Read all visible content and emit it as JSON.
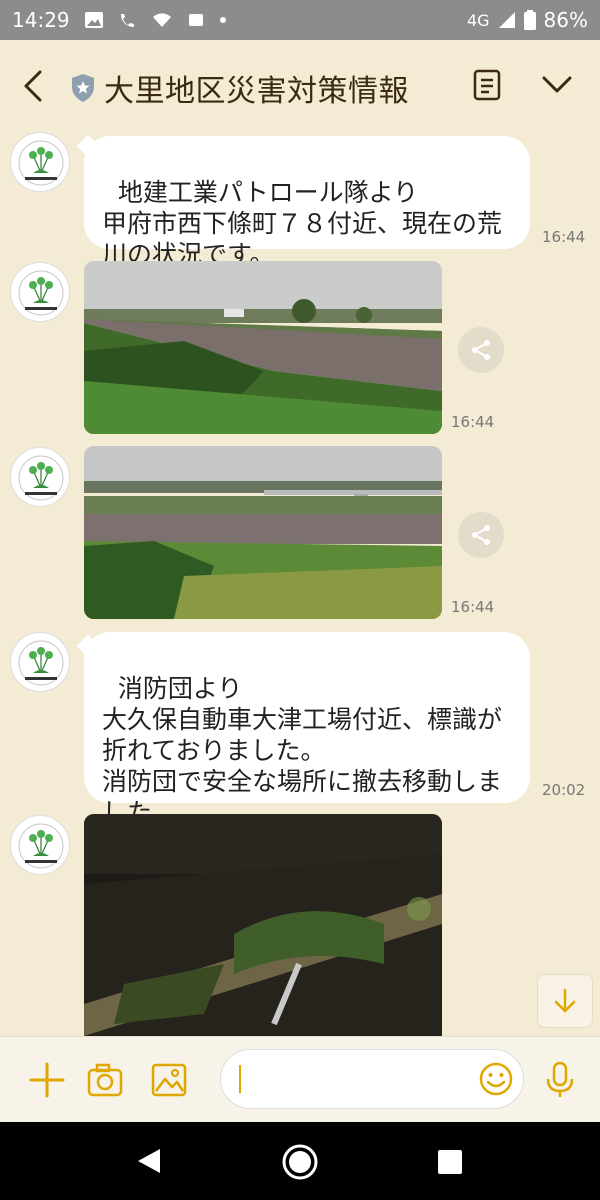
{
  "status_bar": {
    "time": "14:29",
    "network": "4G",
    "battery": "86%"
  },
  "header": {
    "title": "大里地区災害対策情報"
  },
  "messages": [
    {
      "type": "text",
      "text": "地建工業パトロール隊より\n甲府市西下條町７８付近、現在の荒\n川の状況です。",
      "time": "16:44"
    },
    {
      "type": "photo",
      "time": "16:44"
    },
    {
      "type": "photo",
      "time": "16:44"
    },
    {
      "type": "text",
      "text": "消防団より\n大久保自動車大津工場付近、標識が\n折れておりました。\n消防団で安全な場所に撤去移動しま\nした。",
      "time": "20:02"
    },
    {
      "type": "photo"
    }
  ],
  "input": {
    "placeholder": ""
  },
  "icons": {
    "back": "chevron-left-icon",
    "shield": "shield-star-icon",
    "notes": "note-list-icon",
    "menu": "chevron-down-icon",
    "share": "share-icon",
    "scroll": "arrow-down-icon",
    "plus": "plus-icon",
    "camera": "camera-icon",
    "image": "image-icon",
    "emoji": "emoji-icon",
    "mic": "mic-icon"
  },
  "colors": {
    "background": "#f3ebd3",
    "accent": "#e0a700",
    "bubble": "#ffffff",
    "status_bar": "#8c8c8c"
  }
}
